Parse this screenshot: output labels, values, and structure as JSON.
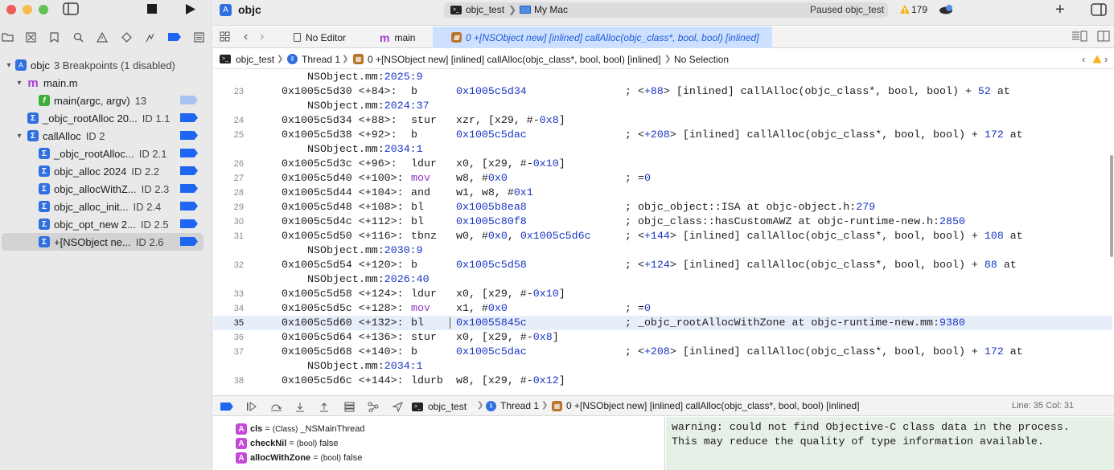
{
  "window": {
    "project": "objc",
    "scheme": "objc_test",
    "destination": "My Mac",
    "status": "Paused objc_test",
    "warning_count": "179"
  },
  "sidebar": {
    "project_label": "objc",
    "project_summary": "3 Breakpoints (1 disabled)",
    "items": [
      {
        "label": "main.m",
        "icon": "m-file-icon",
        "level": 1,
        "disclosure": "▾"
      },
      {
        "label": "main(argc, argv)",
        "id": "13",
        "icon": "function-icon",
        "level": 2,
        "flag": "disabled"
      },
      {
        "label": "_objc_rootAlloc 20...",
        "id": "ID 1.1",
        "icon": "sigma-icon",
        "level": 1,
        "flag": "enabled"
      },
      {
        "label": "callAlloc",
        "id": "ID 2",
        "icon": "sigma-icon",
        "level": 1,
        "disclosure": "▾",
        "flag": "enabled"
      },
      {
        "label": "_objc_rootAlloc...",
        "id": "ID 2.1",
        "icon": "sigma-icon",
        "level": 2,
        "flag": "enabled"
      },
      {
        "label": "objc_alloc 2024",
        "id": "ID 2.2",
        "icon": "sigma-icon",
        "level": 2,
        "flag": "enabled"
      },
      {
        "label": "objc_allocWithZ...",
        "id": "ID 2.3",
        "icon": "sigma-icon",
        "level": 2,
        "flag": "enabled"
      },
      {
        "label": "objc_alloc_init...",
        "id": "ID 2.4",
        "icon": "sigma-icon",
        "level": 2,
        "flag": "enabled"
      },
      {
        "label": "objc_opt_new 2...",
        "id": "ID 2.5",
        "icon": "sigma-icon",
        "level": 2,
        "flag": "enabled"
      },
      {
        "label": "+[NSObject ne...",
        "id": "ID 2.6",
        "icon": "sigma-icon",
        "level": 2,
        "flag": "enabled",
        "selected": true
      }
    ]
  },
  "tabs": [
    {
      "label": "No Editor",
      "icon": "document-icon"
    },
    {
      "label": "main",
      "icon": "m-file-icon"
    },
    {
      "label": "0 +[NSObject new] [inlined] callAlloc(objc_class*, bool, bool) [inlined]",
      "icon": "stack-frame-icon",
      "active": true
    }
  ],
  "jumpbar": {
    "target": "objc_test",
    "thread": "Thread 1",
    "frame": "0 +[NSObject new] [inlined] callAlloc(objc_class*, bool, bool) [inlined]",
    "selection": "No Selection"
  },
  "disasm": {
    "lines": [
      {
        "kind": "cont",
        "text": "NSObject.mm:",
        "num_text": "2025:9"
      },
      {
        "num": "23",
        "addr": "0x1005c5d30 <+84>:",
        "mn": "b",
        "ops": "0x1005c5d34",
        "ops_color": "blue",
        "cm": "; <",
        "cm2": "+88",
        "cm3": "> [inlined] callAlloc(objc_class*, bool, bool) + ",
        "cm4": "52",
        "cm5": " at"
      },
      {
        "kind": "cont",
        "text": "NSObject.mm:",
        "num_text": "2024:37"
      },
      {
        "num": "24",
        "addr": "0x1005c5d34 <+88>:",
        "mn": "stur",
        "ops": "xzr, [x29, #-",
        "ops_tail": "0x8",
        "ops_end": "]"
      },
      {
        "num": "25",
        "addr": "0x1005c5d38 <+92>:",
        "mn": "b",
        "ops": "0x1005c5dac",
        "ops_color": "blue",
        "cm": "; <",
        "cm2": "+208",
        "cm3": "> [inlined] callAlloc(objc_class*, bool, bool) + ",
        "cm4": "172",
        "cm5": " at"
      },
      {
        "kind": "cont",
        "text": "NSObject.mm:",
        "num_text": "2034:1"
      },
      {
        "num": "26",
        "addr": "0x1005c5d3c <+96>:",
        "mn": "ldur",
        "ops": "x0, [x29, #-",
        "ops_tail": "0x10",
        "ops_end": "]"
      },
      {
        "num": "27",
        "addr": "0x1005c5d40 <+100>:",
        "mn": "mov",
        "mn_color": "purp",
        "ops": "w8, #",
        "ops_tail": "0x0",
        "ops_end": "",
        "cm": "; =",
        "cm2": "0"
      },
      {
        "num": "28",
        "addr": "0x1005c5d44 <+104>:",
        "mn": "and",
        "ops": "w1, w8, #",
        "ops_tail": "0x1",
        "ops_end": ""
      },
      {
        "num": "29",
        "addr": "0x1005c5d48 <+108>:",
        "mn": "bl",
        "ops": "0x1005b8ea8",
        "ops_color": "blue",
        "cm": "; objc_object::ISA at objc-object.h:",
        "cm2": "279"
      },
      {
        "num": "30",
        "addr": "0x1005c5d4c <+112>:",
        "mn": "bl",
        "ops": "0x1005c80f8",
        "ops_color": "blue",
        "cm": "; objc_class::hasCustomAWZ at objc-runtime-new.h:",
        "cm2": "2850"
      },
      {
        "num": "31",
        "addr": "0x1005c5d50 <+116>:",
        "mn": "tbnz",
        "ops": "w0, #",
        "ops_tail": "0x0",
        "ops_end": ", ",
        "ops_blue2": "0x1005c5d6c",
        "cm": "; <",
        "cm2": "+144",
        "cm3": "> [inlined] callAlloc(objc_class*, bool, bool) + ",
        "cm4": "108",
        "cm5": " at"
      },
      {
        "kind": "cont",
        "text": "NSObject.mm:",
        "num_text": "2030:9"
      },
      {
        "num": "32",
        "addr": "0x1005c5d54 <+120>:",
        "mn": "b",
        "ops": "0x1005c5d58",
        "ops_color": "blue",
        "cm": "; <",
        "cm2": "+124",
        "cm3": "> [inlined] callAlloc(objc_class*, bool, bool) + ",
        "cm4": "88",
        "cm5": " at"
      },
      {
        "kind": "cont",
        "text": "NSObject.mm:",
        "num_text": "2026:40"
      },
      {
        "num": "33",
        "addr": "0x1005c5d58 <+124>:",
        "mn": "ldur",
        "ops": "x0, [x29, #-",
        "ops_tail": "0x10",
        "ops_end": "]"
      },
      {
        "num": "34",
        "addr": "0x1005c5d5c <+128>:",
        "mn": "mov",
        "mn_color": "purp",
        "ops": "x1, #",
        "ops_tail": "0x0",
        "ops_end": "",
        "cm": "; =",
        "cm2": "0"
      },
      {
        "num": "35",
        "addr": "0x1005c5d60 <+132>:",
        "mn": "bl",
        "ops": "0x10055845c",
        "ops_color": "blue",
        "cm": "; _objc_rootAllocWithZone at objc-runtime-new.mm:",
        "cm2": "9380",
        "current": true
      },
      {
        "num": "36",
        "addr": "0x1005c5d64 <+136>:",
        "mn": "stur",
        "ops": "x0, [x29, #-",
        "ops_tail": "0x8",
        "ops_end": "]"
      },
      {
        "num": "37",
        "addr": "0x1005c5d68 <+140>:",
        "mn": "b",
        "ops": "0x1005c5dac",
        "ops_color": "blue",
        "cm": "; <",
        "cm2": "+208",
        "cm3": "> [inlined] callAlloc(objc_class*, bool, bool) + ",
        "cm4": "172",
        "cm5": " at"
      },
      {
        "kind": "cont",
        "text": "NSObject.mm:",
        "num_text": "2034:1"
      },
      {
        "num": "38",
        "addr": "0x1005c5d6c <+144>:",
        "mn": "ldurb",
        "ops": "w8, [x29, #-",
        "ops_tail": "0x12",
        "ops_end": "]"
      }
    ]
  },
  "debugbar": {
    "target": "objc_test",
    "thread": "Thread 1",
    "frame": "0 +[NSObject new] [inlined] callAlloc(objc_class*, bool, bool) [inlined]",
    "position": "Line: 35  Col: 31"
  },
  "variables": [
    {
      "name": "cls",
      "type": "(Class)",
      "value": "_NSMainThread"
    },
    {
      "name": "checkNil",
      "type": "(bool)",
      "value": "false"
    },
    {
      "name": "allocWithZone",
      "type": "(bool)",
      "value": "false"
    }
  ],
  "console": {
    "text": "warning: could not find Objective-C class data in the process.\nThis may reduce the quality of type information available."
  },
  "colors": {
    "accent": "#1e65f2",
    "breakpoint_disabled": "#a9c3f0",
    "current_line": "#e8eef9",
    "console_bg": "#e7f0e6",
    "number_blue": "#1935c2",
    "mnemonic_purple": "#8e35c4"
  }
}
